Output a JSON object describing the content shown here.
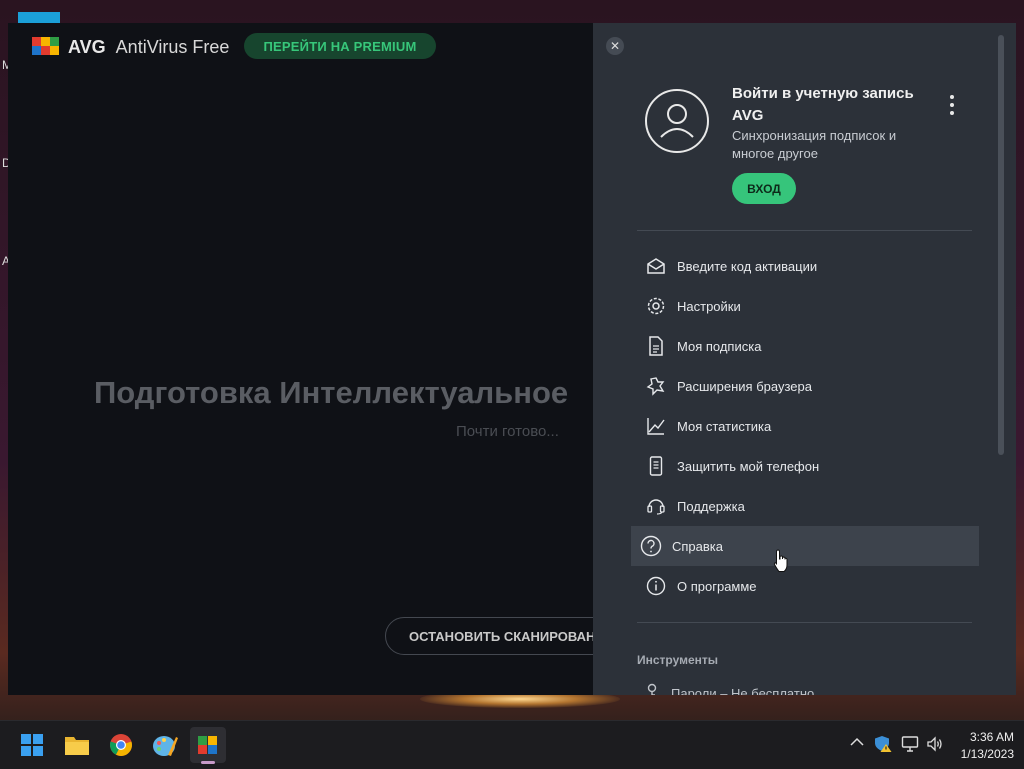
{
  "desktop": {
    "edge_letters": [
      "M",
      "D",
      "A"
    ]
  },
  "app": {
    "brand": "AVG",
    "product": "AntiVirus Free",
    "premium_label": "ПЕРЕЙТИ НА PREMIUM",
    "scan_title": "Подготовка Интеллектуальное",
    "scan_subtitle": "Почти готово...",
    "stop_label": "ОСТАНОВИТЬ СКАНИРОВАН"
  },
  "panel": {
    "close_symbol": "✕",
    "account_title": "Войти в учетную запись AVG",
    "account_subtitle": "Синхронизация подписок и многое другое",
    "login_label": "ВХОД",
    "menu": [
      {
        "label": "Введите код активации",
        "icon": "envelope-icon"
      },
      {
        "label": "Настройки",
        "icon": "gear-icon"
      },
      {
        "label": "Моя подписка",
        "icon": "document-icon"
      },
      {
        "label": "Расширения браузера",
        "icon": "puzzle-icon"
      },
      {
        "label": "Моя статистика",
        "icon": "chart-icon"
      },
      {
        "label": "Защитить мой телефон",
        "icon": "phone-icon"
      },
      {
        "label": "Поддержка",
        "icon": "headset-icon"
      },
      {
        "label": "Справка",
        "icon": "question-icon"
      },
      {
        "label": "О программе",
        "icon": "info-icon"
      }
    ],
    "highlighted_index": 7,
    "tools_heading": "Инструменты",
    "tools_item": "Пароли – Не бесплатно"
  },
  "taskbar": {
    "apps": [
      "start-icon",
      "file-explorer-icon",
      "chrome-icon",
      "paint-icon",
      "avg-icon"
    ],
    "time": "3:36 AM",
    "date": "1/13/2023"
  },
  "colors": {
    "accent_green": "#36c57b",
    "panel_bg": "#2c3139",
    "window_bg": "#0f1116"
  }
}
